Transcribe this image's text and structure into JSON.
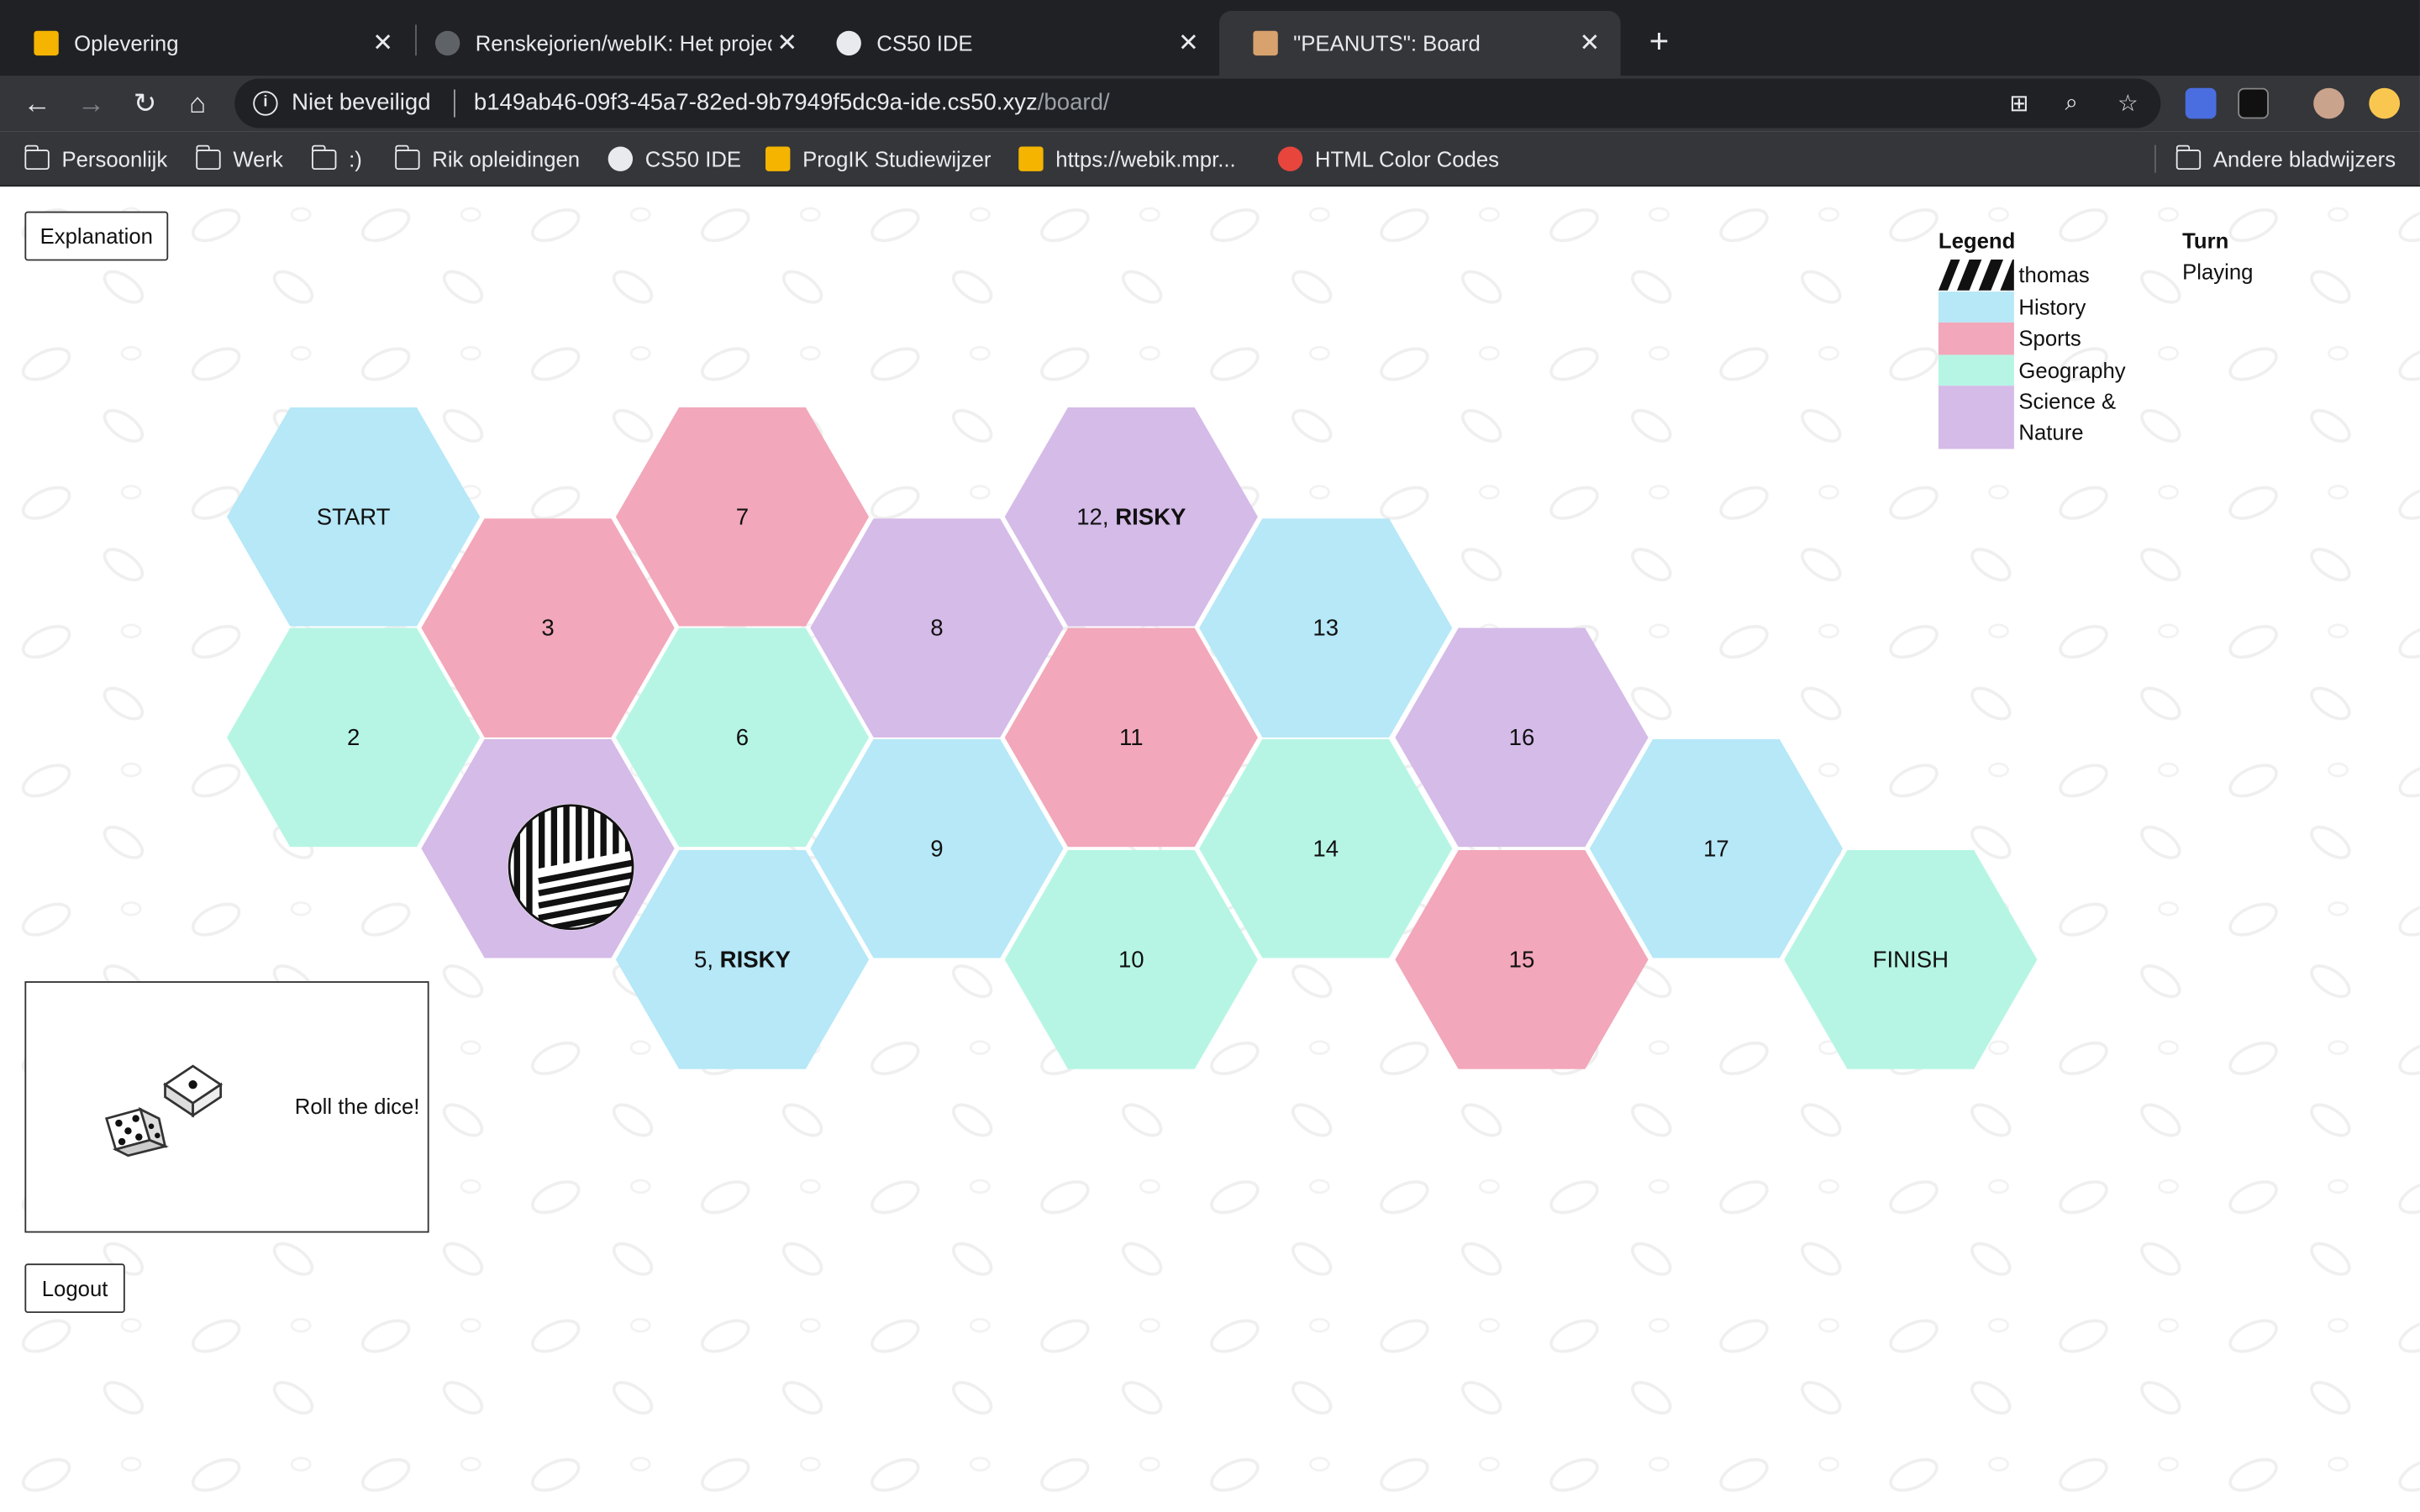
{
  "browser": {
    "tabs": [
      {
        "title": "Oplevering",
        "active": false
      },
      {
        "title": "Renskejorien/webIK: Het projec",
        "active": false
      },
      {
        "title": "CS50 IDE",
        "active": false
      },
      {
        "title": "\"PEANUTS\": Board",
        "active": true
      }
    ],
    "address": {
      "security": "Niet beveiligd",
      "host": "b149ab46-09f3-45a7-82ed-9b7949f5dc9a-ide.cs50.xyz",
      "path": "/board/"
    },
    "bookmarks": [
      {
        "label": "Persoonlijk",
        "icon": "folder-icon"
      },
      {
        "label": "Werk",
        "icon": "folder-icon"
      },
      {
        "label": ":)",
        "icon": "folder-icon"
      },
      {
        "label": "Rik opleidingen",
        "icon": "folder-icon"
      },
      {
        "label": "CS50 IDE",
        "icon": "globe-icon"
      },
      {
        "label": "ProgIK Studiewijzer",
        "icon": "yellow-favicon"
      },
      {
        "label": "https://webik.mpr...",
        "icon": "yellow-favicon"
      },
      {
        "label": "HTML Color Codes",
        "icon": "red-favicon"
      }
    ],
    "other_bookmarks": "Andere bladwijzers"
  },
  "page": {
    "explanation_label": "Explanation",
    "logout_label": "Logout",
    "legend": {
      "title": "Legend",
      "items": [
        {
          "label": "thomas",
          "kind": "player-stripes"
        },
        {
          "label": "History",
          "color": "#b6e8f7"
        },
        {
          "label": "Sports",
          "color": "#f2a7ba"
        },
        {
          "label": "Geography",
          "color": "#b6f5e4"
        },
        {
          "label": "Science & Nature",
          "color": "#d5bbe8"
        }
      ]
    },
    "turn": {
      "title": "Turn",
      "status": "Playing"
    },
    "dice": {
      "prompt": "Roll the dice!"
    },
    "board": {
      "tiles": [
        {
          "label": "START",
          "category": "History"
        },
        {
          "label": "2",
          "category": "Geography"
        },
        {
          "label": "3",
          "category": "Sports"
        },
        {
          "label": "",
          "category": "Science & Nature",
          "player": "thomas"
        },
        {
          "label": "5, ",
          "risky": "RISKY",
          "category": "History"
        },
        {
          "label": "6",
          "category": "Geography"
        },
        {
          "label": "7",
          "category": "Sports"
        },
        {
          "label": "8",
          "category": "Science & Nature"
        },
        {
          "label": "9",
          "category": "History"
        },
        {
          "label": "10",
          "category": "Geography"
        },
        {
          "label": "11",
          "category": "Sports"
        },
        {
          "label": "12, ",
          "risky": "RISKY",
          "category": "Science & Nature"
        },
        {
          "label": "13",
          "category": "History"
        },
        {
          "label": "14",
          "category": "Geography"
        },
        {
          "label": "15",
          "category": "Sports"
        },
        {
          "label": "16",
          "category": "Science & Nature"
        },
        {
          "label": "17",
          "category": "History"
        },
        {
          "label": "FINISH",
          "category": "Geography"
        }
      ]
    }
  }
}
